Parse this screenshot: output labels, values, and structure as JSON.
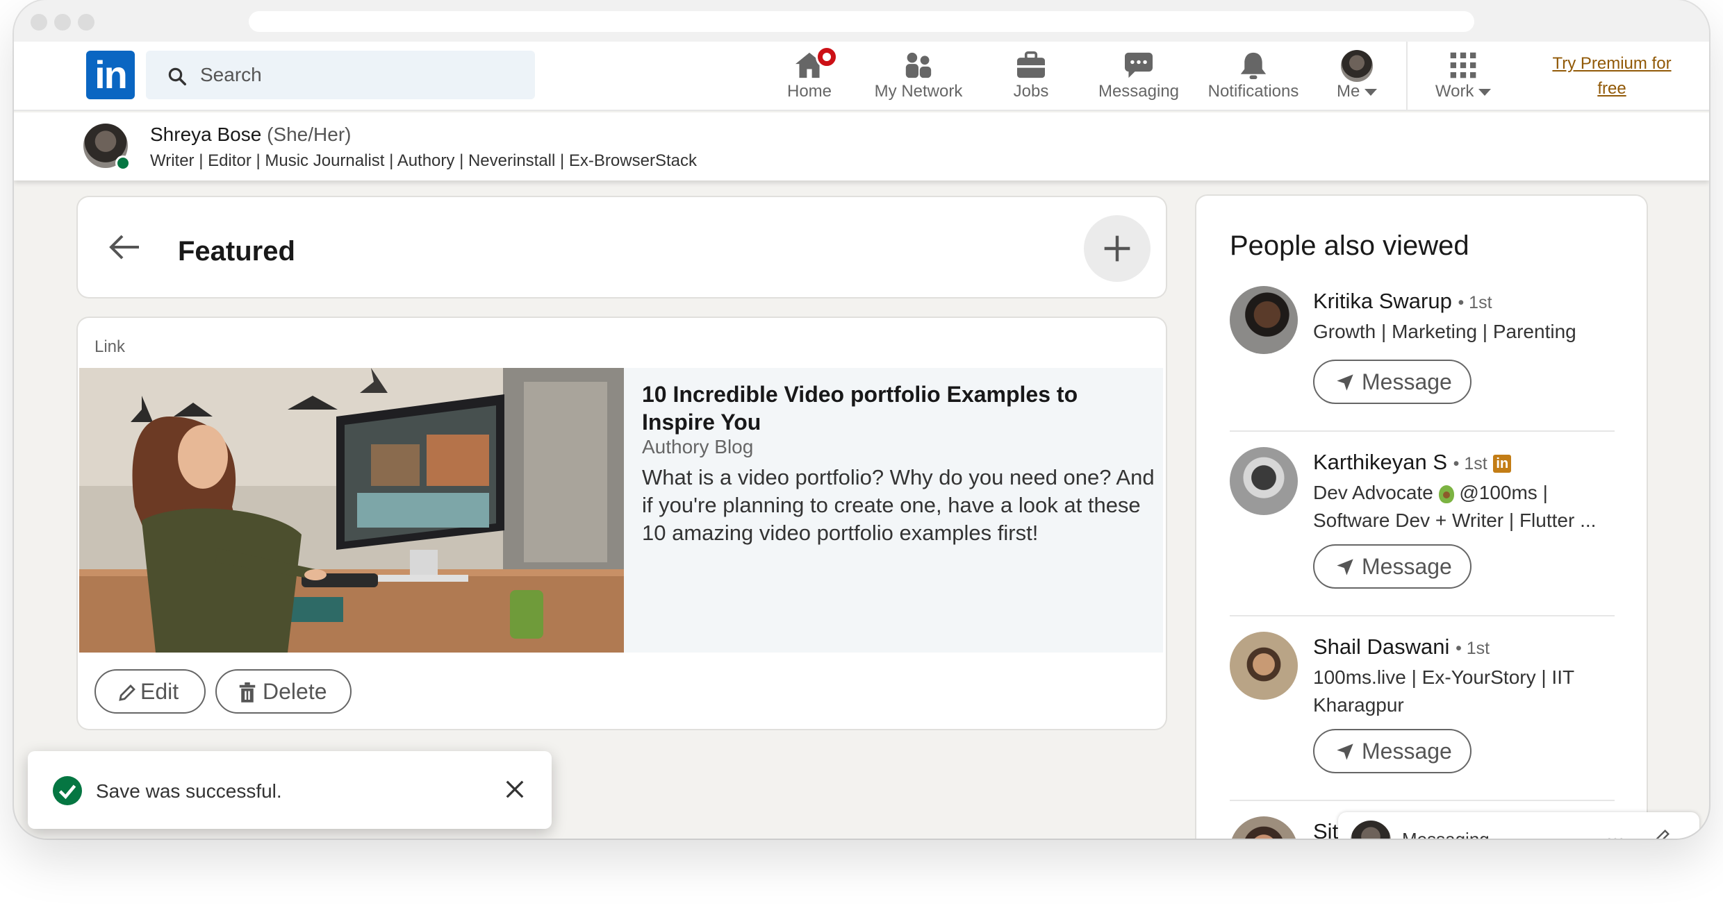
{
  "nav": {
    "search_placeholder": "Search",
    "items": [
      {
        "label": "Home",
        "icon": "home-icon"
      },
      {
        "label": "My Network",
        "icon": "my-network-icon"
      },
      {
        "label": "Jobs",
        "icon": "briefcase-icon"
      },
      {
        "label": "Messaging",
        "icon": "messaging-icon"
      },
      {
        "label": "Notifications",
        "icon": "bell-icon"
      },
      {
        "label": "Me",
        "icon": "avatar"
      },
      {
        "label": "Work",
        "icon": "grid-icon"
      }
    ],
    "premium_line1": "Try Premium for",
    "premium_line2": "free",
    "brand_color": "#0a66c2",
    "badge_color": "#cc1016"
  },
  "profile": {
    "name": "Shreya Bose",
    "pronouns": "(She/Her)",
    "headline": "Writer | Editor | Music Journalist | Authory | Neverinstall | Ex-BrowserStack"
  },
  "featured": {
    "title": "Featured",
    "item": {
      "type_label": "Link",
      "title": "10 Incredible Video portfolio Examples to Inspire You",
      "source": "Authory Blog",
      "description": "What is a video portfolio? Why do you need one? And if you're planning to create one, have a look at these 10 amazing video portfolio examples first!",
      "edit_label": "Edit",
      "delete_label": "Delete"
    }
  },
  "sidebar": {
    "title": "People also viewed",
    "people": [
      {
        "name": "Kritika Swarup",
        "degree": "• 1st",
        "headline": "Growth | Marketing | Parenting",
        "button": "Message"
      },
      {
        "name": "Karthikeyan S",
        "degree": "• 1st",
        "headline_line1": "Dev Advocate",
        "headline_line1b": "@100ms |",
        "headline_line2": "Software Dev + Writer | Flutter ...",
        "button": "Message"
      },
      {
        "name": "Shail Daswani",
        "degree": "• 1st",
        "headline": "100ms.live | Ex-YourStory | IIT Kharagpur",
        "button": "Message"
      },
      {
        "name_partial": "Sit"
      }
    ]
  },
  "messaging_dock": {
    "label": "Messaging"
  },
  "toast": {
    "text": "Save was successful."
  }
}
